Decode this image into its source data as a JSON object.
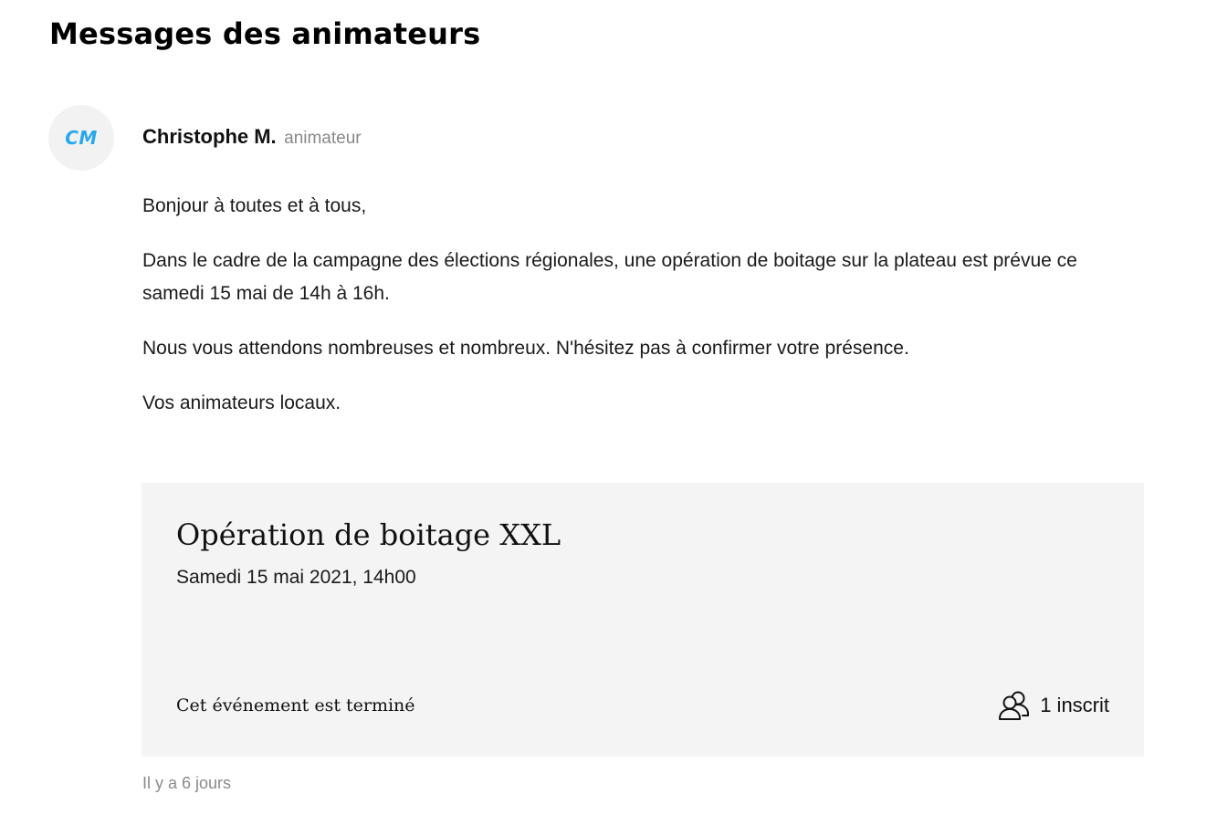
{
  "page": {
    "title": "Messages des animateurs"
  },
  "message": {
    "avatar_initials": "CM",
    "author_name": "Christophe M.",
    "author_role": "animateur",
    "paragraphs": [
      "Bonjour à toutes et à tous,",
      "Dans le cadre de la campagne des élections régionales, une opération de boitage sur la plateau est prévue ce samedi 15 mai de 14h à 16h.",
      "Nous vous attendons nombreuses et nombreux. N'hésitez pas à confirmer votre présence.",
      "Vos animateurs locaux."
    ],
    "timestamp": "Il y a 6 jours"
  },
  "event": {
    "title": "Opération de boitage XXL",
    "date": "Samedi 15 mai 2021, 14h00",
    "status": "Cet événement est terminé",
    "participants_label": "1 inscrit",
    "participants_icon": "users-icon"
  },
  "colors": {
    "avatar_initials": "#2aa7e8",
    "avatar_background": "#f2f2f2",
    "card_background": "#f4f4f4",
    "muted_text": "#888888"
  }
}
